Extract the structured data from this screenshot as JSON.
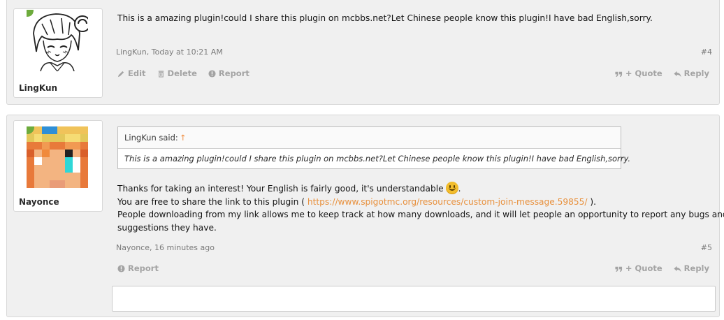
{
  "posts": [
    {
      "username": "LingKun",
      "avatar": "anime-girl-sketch-avatar",
      "message": "This is a amazing plugin!could I share this plugin on mcbbs.net?Let Chinese people know this plugin!I have bad English,sorry.",
      "meta": "LingKun, Today at 10:21 AM",
      "post_number": "#4",
      "actions_left": [
        {
          "icon": "pencil-icon",
          "label": "Edit"
        },
        {
          "icon": "trash-icon",
          "label": "Delete"
        },
        {
          "icon": "report-icon",
          "label": "Report"
        }
      ],
      "actions_right": [
        {
          "icon": "quote-icon",
          "label": "+ Quote"
        },
        {
          "icon": "reply-icon",
          "label": "Reply"
        }
      ]
    },
    {
      "username": "Nayonce",
      "avatar": "minecraft-pixel-avatar",
      "quote": {
        "author_label": "LingKun said:",
        "arrow": "↑",
        "text": "This is a amazing plugin!could I share this plugin on mcbbs.net?Let Chinese people know this plugin!I have bad English,sorry."
      },
      "message_lines": {
        "line1": "Thanks for taking an interest! Your English is fairly good, it's understandable",
        "line1_end": ".",
        "line2_start": "You are free to share the link to this plugin (",
        "line2_link": "https://www.spigotmc.org/resources/custom-join-message.59855/",
        "line2_end": ").",
        "line3": "People downloading from my link allows me to keep track at how many downloads, and it will let people an opportunity to report any bugs and",
        "line4": "suggestions they have."
      },
      "meta": "Nayonce, 16 minutes ago",
      "post_number": "#5",
      "actions_left": [
        {
          "icon": "report-icon",
          "label": "Report"
        }
      ],
      "actions_right": [
        {
          "icon": "quote-icon",
          "label": "+ Quote"
        },
        {
          "icon": "reply-icon",
          "label": "Reply"
        }
      ]
    }
  ],
  "colors": {
    "link": "#e8903c",
    "action": "#a3a3a3",
    "panel": "#f0f0f0"
  }
}
